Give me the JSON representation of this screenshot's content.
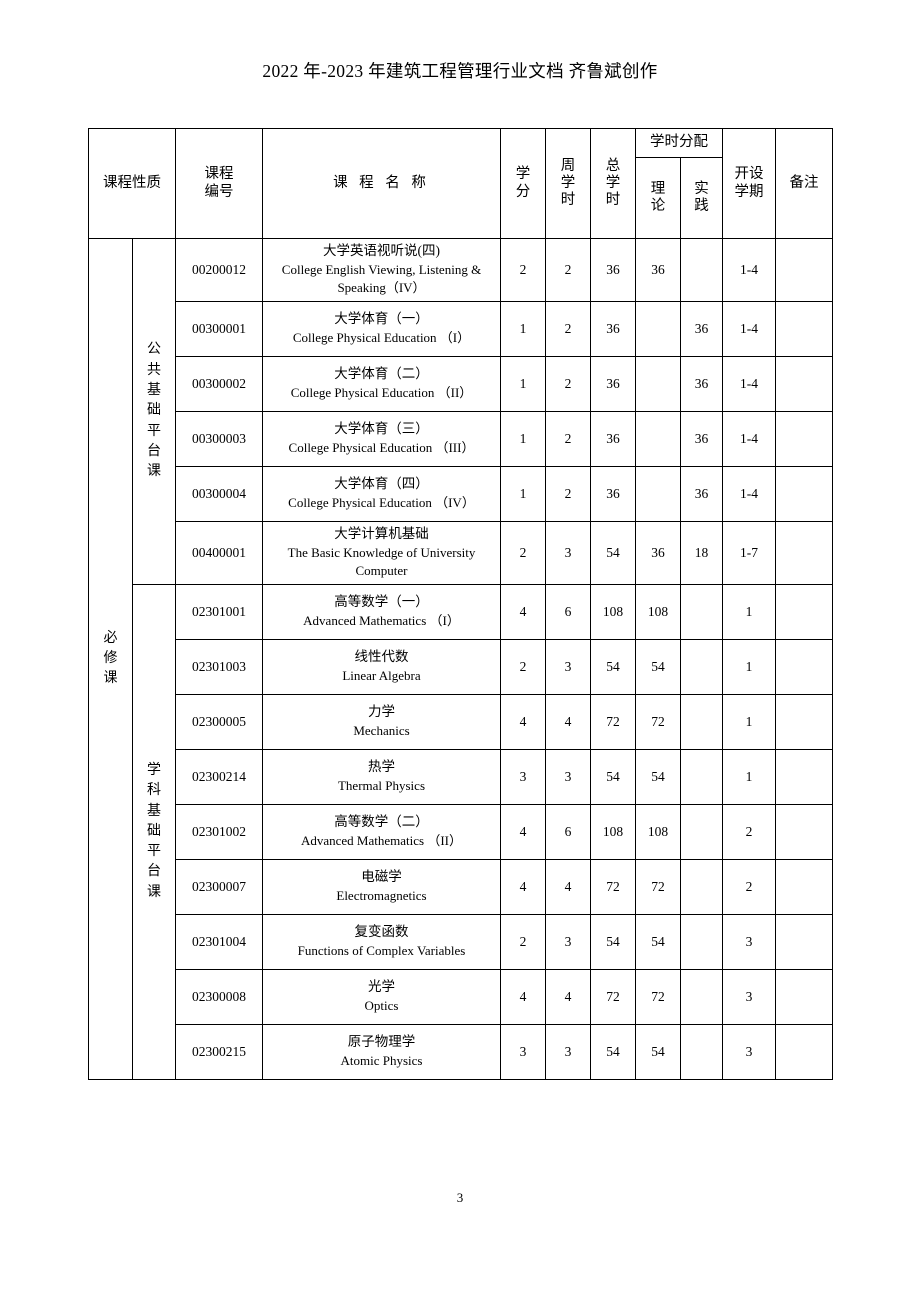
{
  "document": {
    "header_text": "2022 年-2023 年建筑工程管理行业文档 齐鲁斌创作",
    "page_number": "3"
  },
  "table": {
    "headers": {
      "nature": "课程性质",
      "code_line1": "课程",
      "code_line2": "编号",
      "name": "课 程 名 称",
      "credit_line1": "学",
      "credit_line2": "分",
      "weekly_line1": "周",
      "weekly_line2": "学",
      "weekly_line3": "时",
      "total_line1": "总",
      "total_line2": "学",
      "total_line3": "时",
      "allocation": "学时分配",
      "theory_line1": "理",
      "theory_line2": "论",
      "practice_line1": "实",
      "practice_line2": "践",
      "term_line1": "开设",
      "term_line2": "学期",
      "remark": "备注"
    },
    "group_labels": {
      "required": "必修课",
      "public_platform": "公共基础平台课",
      "discipline_platform": "学科基础平台课"
    },
    "rows": [
      {
        "code": "00200012",
        "name_cn": "大学英语视听说(四)",
        "name_en": "College English Viewing, Listening & Speaking（IV）",
        "credit": "2",
        "weekly": "2",
        "total": "36",
        "theory": "36",
        "practice": "",
        "term": "1-4",
        "remark": ""
      },
      {
        "code": "00300001",
        "name_cn": "大学体育（一）",
        "name_en": "College Physical Education （I）",
        "credit": "1",
        "weekly": "2",
        "total": "36",
        "theory": "",
        "practice": "36",
        "term": "1-4",
        "remark": ""
      },
      {
        "code": "00300002",
        "name_cn": "大学体育（二）",
        "name_en": "College Physical Education （II）",
        "credit": "1",
        "weekly": "2",
        "total": "36",
        "theory": "",
        "practice": "36",
        "term": "1-4",
        "remark": ""
      },
      {
        "code": "00300003",
        "name_cn": "大学体育（三）",
        "name_en": "College Physical Education （III）",
        "credit": "1",
        "weekly": "2",
        "total": "36",
        "theory": "",
        "practice": "36",
        "term": "1-4",
        "remark": ""
      },
      {
        "code": "00300004",
        "name_cn": "大学体育（四）",
        "name_en": "College Physical Education （IV）",
        "credit": "1",
        "weekly": "2",
        "total": "36",
        "theory": "",
        "practice": "36",
        "term": "1-4",
        "remark": ""
      },
      {
        "code": "00400001",
        "name_cn": "大学计算机基础",
        "name_en": "The Basic Knowledge of University Computer",
        "credit": "2",
        "weekly": "3",
        "total": "54",
        "theory": "36",
        "practice": "18",
        "term": "1-7",
        "remark": ""
      },
      {
        "code": "02301001",
        "name_cn": "高等数学（一）",
        "name_en": "Advanced Mathematics （I）",
        "credit": "4",
        "weekly": "6",
        "total": "108",
        "theory": "108",
        "practice": "",
        "term": "1",
        "remark": ""
      },
      {
        "code": "02301003",
        "name_cn": "线性代数",
        "name_en": "Linear Algebra",
        "credit": "2",
        "weekly": "3",
        "total": "54",
        "theory": "54",
        "practice": "",
        "term": "1",
        "remark": ""
      },
      {
        "code": "02300005",
        "name_cn": "力学",
        "name_en": "Mechanics",
        "credit": "4",
        "weekly": "4",
        "total": "72",
        "theory": "72",
        "practice": "",
        "term": "1",
        "remark": ""
      },
      {
        "code": "02300214",
        "name_cn": "热学",
        "name_en": "Thermal Physics",
        "credit": "3",
        "weekly": "3",
        "total": "54",
        "theory": "54",
        "practice": "",
        "term": "1",
        "remark": ""
      },
      {
        "code": "02301002",
        "name_cn": "高等数学（二）",
        "name_en": "Advanced Mathematics （II）",
        "credit": "4",
        "weekly": "6",
        "total": "108",
        "theory": "108",
        "practice": "",
        "term": "2",
        "remark": ""
      },
      {
        "code": "02300007",
        "name_cn": "电磁学",
        "name_en": "Electromagnetics",
        "credit": "4",
        "weekly": "4",
        "total": "72",
        "theory": "72",
        "practice": "",
        "term": "2",
        "remark": ""
      },
      {
        "code": "02301004",
        "name_cn": "复变函数",
        "name_en": "Functions of Complex Variables",
        "credit": "2",
        "weekly": "3",
        "total": "54",
        "theory": "54",
        "practice": "",
        "term": "3",
        "remark": ""
      },
      {
        "code": "02300008",
        "name_cn": "光学",
        "name_en": "Optics",
        "credit": "4",
        "weekly": "4",
        "total": "72",
        "theory": "72",
        "practice": "",
        "term": "3",
        "remark": ""
      },
      {
        "code": "02300215",
        "name_cn": "原子物理学",
        "name_en": "Atomic Physics",
        "credit": "3",
        "weekly": "3",
        "total": "54",
        "theory": "54",
        "practice": "",
        "term": "3",
        "remark": ""
      }
    ]
  }
}
